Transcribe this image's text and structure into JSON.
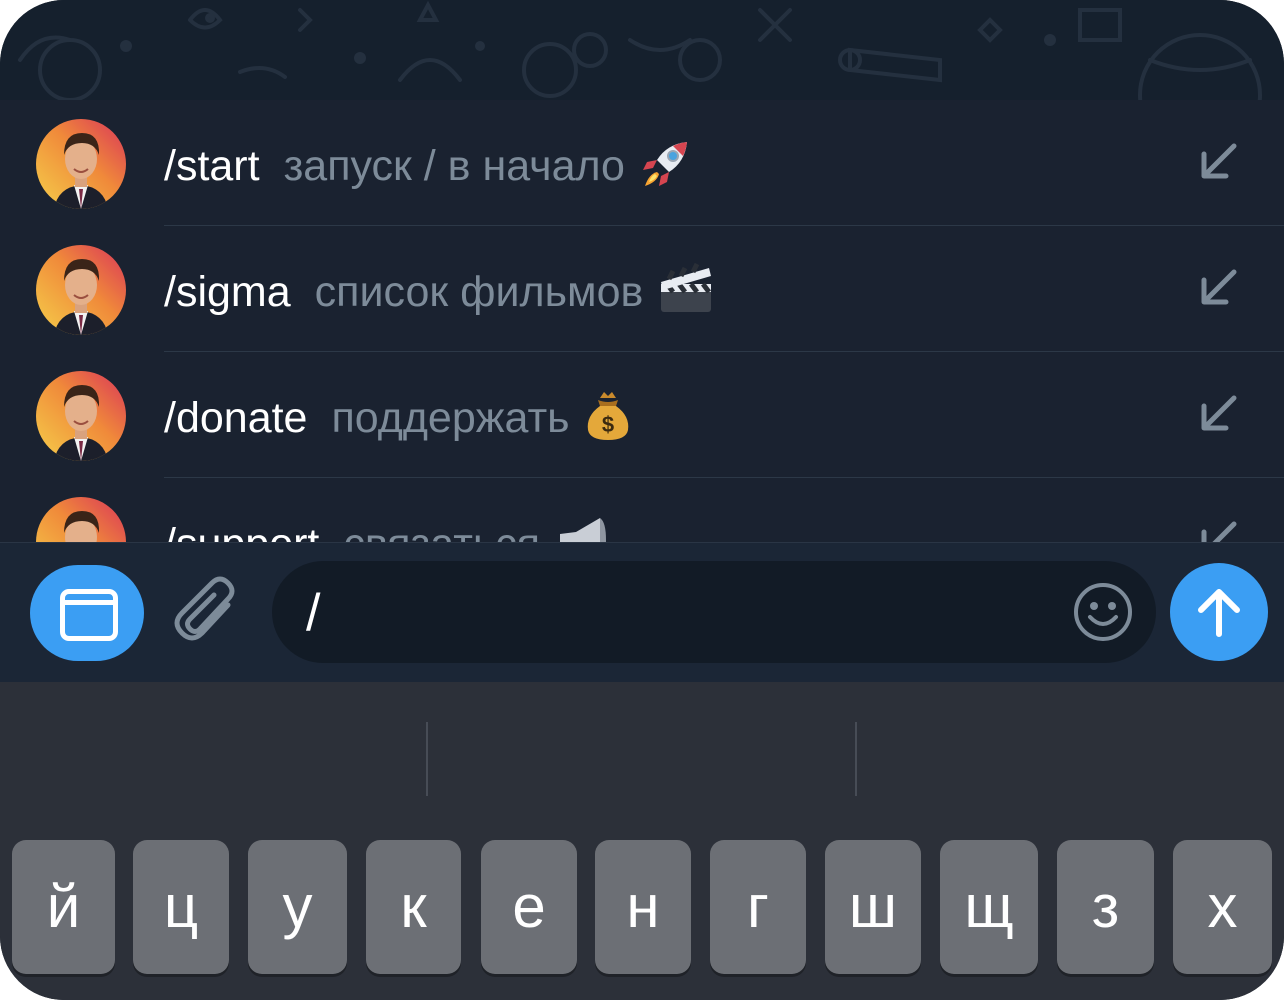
{
  "commands": [
    {
      "name": "/start",
      "description": "запуск / в начало",
      "emoji": "rocket"
    },
    {
      "name": "/sigma",
      "description": "список фильмов",
      "emoji": "clapper-board"
    },
    {
      "name": "/donate",
      "description": "поддержать",
      "emoji": "money-bag"
    },
    {
      "name": "/support",
      "description": "связаться",
      "emoji": "megaphone"
    }
  ],
  "input": {
    "value": "/"
  },
  "keyboard": {
    "row1": [
      "й",
      "ц",
      "у",
      "к",
      "е",
      "н",
      "г",
      "ш",
      "щ",
      "з",
      "х"
    ]
  },
  "colors": {
    "accent": "#3b9ef3",
    "panel": "#1a2230",
    "muted_text": "#7d8b99",
    "key": "#6c6f75"
  }
}
